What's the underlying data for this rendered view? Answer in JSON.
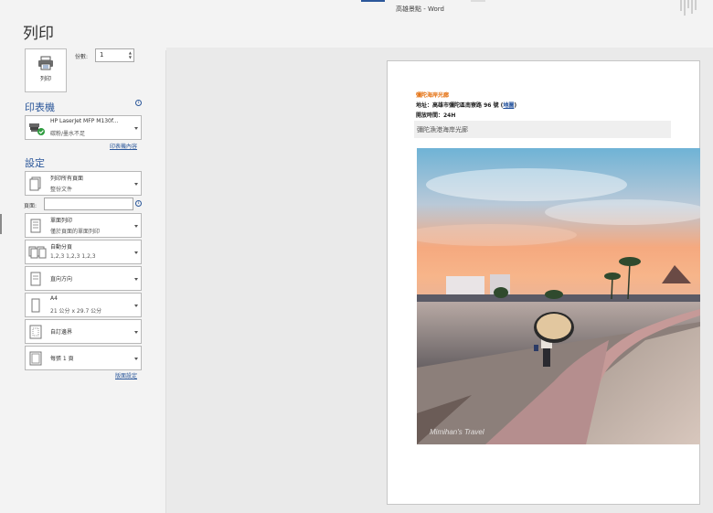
{
  "window": {
    "title": "高雄景點 - Word"
  },
  "backstage": {
    "title": "列印",
    "print_button_label": "列印",
    "copies_label": "份數:",
    "copies_value": "1"
  },
  "printer": {
    "heading": "印表機",
    "name": "HP LaserJet MFP M130f...",
    "status": "碳粉/墨水不足",
    "properties_link": "印表機內容"
  },
  "settings": {
    "heading": "設定",
    "pages_label": "頁面:",
    "pages_value": "",
    "dropdowns": [
      {
        "line1": "列印所有頁面",
        "line2": "整份文件",
        "icon": "pages-icon"
      },
      {
        "line1": "單面列印",
        "line2": "僅於頁面的單面列印",
        "icon": "one-sided-icon"
      },
      {
        "line1": "自動分頁",
        "line2": "1,2,3    1,2,3    1,2,3",
        "icon": "collate-icon"
      },
      {
        "line1": "直向方向",
        "line2": "",
        "icon": "portrait-icon"
      },
      {
        "line1": "A4",
        "line2": "21 公分 x 29.7 公分",
        "icon": "paper-size-icon"
      },
      {
        "line1": "自訂邊界",
        "line2": "",
        "icon": "margins-icon"
      },
      {
        "line1": "每張 1 頁",
        "line2": "",
        "icon": "pages-per-sheet-icon"
      }
    ],
    "page_setup_link": "版面設定"
  },
  "document": {
    "title": "彌陀海岸光廊",
    "address_prefix": "地址：高雄市彌陀區南寮路 96 號  (",
    "map_link": "地圖",
    "address_suffix": ")",
    "hours": "開放時間：24H",
    "caption": "彌陀漁港海岸光廊",
    "watermark": "Mimihan's Travel"
  },
  "colors": {
    "accent": "#2b579a",
    "doc_title": "#e36c09"
  }
}
